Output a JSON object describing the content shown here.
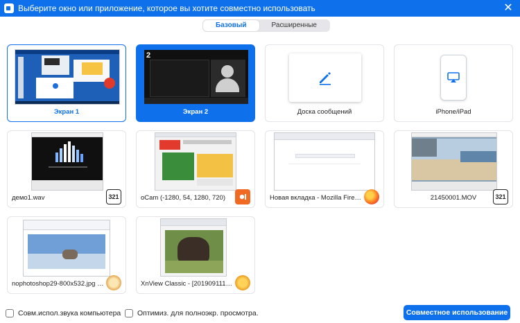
{
  "window": {
    "title": "Выберите окно или приложение, которое вы хотите совместно использовать",
    "close_glyph": "✕",
    "accent": "#0e71eb"
  },
  "tabs": [
    {
      "label": "Базовый",
      "active": true
    },
    {
      "label": "Расширенные",
      "active": false
    }
  ],
  "tiles": [
    {
      "label": "Экран 1",
      "icon": "screen-thumbnail"
    },
    {
      "label": "Экран 2",
      "icon": "screen-thumbnail",
      "number": "2"
    },
    {
      "label": "Доска сообщений",
      "icon": "pencil-icon"
    },
    {
      "label": "iPhone/iPad",
      "icon": "airplay-icon"
    },
    {
      "label": "демо1.wav",
      "icon": "media-player-classic-icon",
      "badge": "321"
    },
    {
      "label": "oCam (-1280, 54, 1280, 720)",
      "icon": "ocam-icon"
    },
    {
      "label": "Новая вкладка - Mozilla Firefox",
      "icon": "firefox-icon"
    },
    {
      "label": "21450001.MOV",
      "icon": "media-player-classic-icon",
      "badge": "321"
    },
    {
      "label": "nophotoshop29-800x532.jpg - Pa...",
      "icon": "paint-icon"
    },
    {
      "label": "XnView Classic - [2019091115522...",
      "icon": "xnview-icon"
    }
  ],
  "footer": {
    "share_sound_label": "Совм.испол.звука компьютера",
    "optimize_label": "Оптимиз. для полноэкр. просмотра.",
    "share_button_label": "Совместное использование"
  }
}
